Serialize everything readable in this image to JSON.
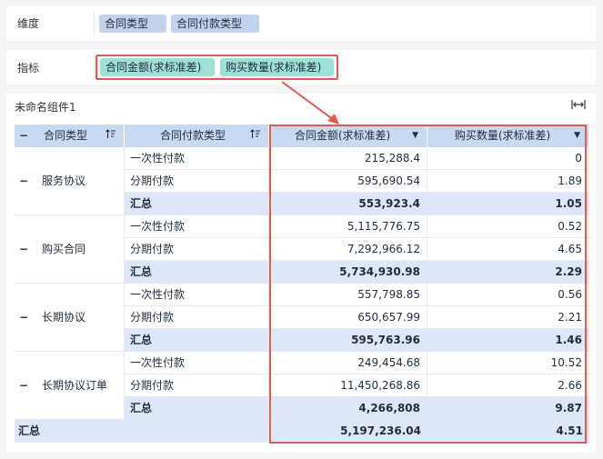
{
  "dimension": {
    "label": "维度",
    "chips": [
      "合同类型",
      "合同付款类型"
    ]
  },
  "indicator": {
    "label": "指标",
    "chips": [
      "合同金额(求标准差)",
      "购买数量(求标准差)"
    ]
  },
  "component": {
    "title": "未命名组件1"
  },
  "table": {
    "headers": [
      "合同类型",
      "合同付款类型",
      "合同金额(求标准差)",
      "购买数量(求标准差)"
    ],
    "groups": [
      {
        "name": "服务协议",
        "rows": [
          {
            "type": "一次性付款",
            "amount": "215,288.4",
            "qty": "0"
          },
          {
            "type": "分期付款",
            "amount": "595,690.54",
            "qty": "1.89"
          },
          {
            "type": "汇总",
            "amount": "553,923.4",
            "qty": "1.05"
          }
        ]
      },
      {
        "name": "购买合同",
        "rows": [
          {
            "type": "一次性付款",
            "amount": "5,115,776.75",
            "qty": "0.52"
          },
          {
            "type": "分期付款",
            "amount": "7,292,966.12",
            "qty": "4.65"
          },
          {
            "type": "汇总",
            "amount": "5,734,930.98",
            "qty": "2.29"
          }
        ]
      },
      {
        "name": "长期协议",
        "rows": [
          {
            "type": "一次性付款",
            "amount": "557,798.85",
            "qty": "0.56"
          },
          {
            "type": "分期付款",
            "amount": "650,657.99",
            "qty": "2.21"
          },
          {
            "type": "汇总",
            "amount": "595,763.96",
            "qty": "1.46"
          }
        ]
      },
      {
        "name": "长期协议订单",
        "rows": [
          {
            "type": "一次性付款",
            "amount": "249,454.68",
            "qty": "10.52"
          },
          {
            "type": "分期付款",
            "amount": "11,450,268.86",
            "qty": "2.66"
          },
          {
            "type": "汇总",
            "amount": "4,266,808",
            "qty": "9.87"
          }
        ]
      }
    ],
    "total": {
      "label": "汇总",
      "amount": "5,197,236.04",
      "qty": "4.51"
    }
  },
  "colors": {
    "header": "#c9d9f1",
    "summary": "#dce8f8",
    "highlight": "#e8594a",
    "dim_chip": "#c4d1ec",
    "ind_chip": "#9fe0d6"
  },
  "icons": {
    "collapse": "minus-icon",
    "sort": "sort-icon",
    "dropdown": "caret-down-icon",
    "expand": "expand-width-icon"
  }
}
